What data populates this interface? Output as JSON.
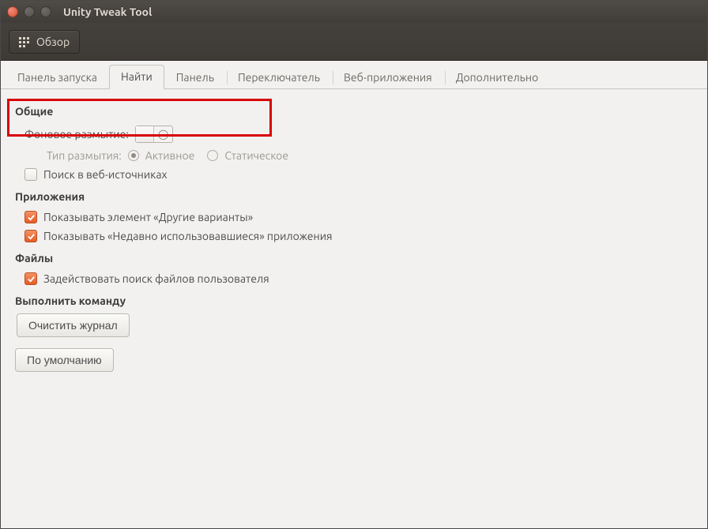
{
  "window": {
    "title": "Unity Tweak Tool"
  },
  "toolbar": {
    "overview_label": "Обзор"
  },
  "tabs": [
    {
      "label": "Панель запуска"
    },
    {
      "label": "Найти"
    },
    {
      "label": "Панель"
    },
    {
      "label": "Переключатель"
    },
    {
      "label": "Веб-приложения"
    },
    {
      "label": "Дополнительно"
    }
  ],
  "sections": {
    "general": {
      "title": "Общие",
      "blur_label": "Фоновое размытие:",
      "blur_type_label": "Тип размытия:",
      "blur_type_options": {
        "active": "Активное",
        "static": "Статическое"
      },
      "search_web_label": "Поиск в веб-источниках"
    },
    "apps": {
      "title": "Приложения",
      "show_more": "Показывать элемент «Другие варианты»",
      "show_recent": "Показывать «Недавно использовавшиеся» приложения"
    },
    "files": {
      "title": "Файлы",
      "user_files": "Задействовать поиск файлов пользователя"
    },
    "run": {
      "title": "Выполнить команду",
      "clear_btn": "Очистить журнал"
    }
  },
  "footer": {
    "defaults_btn": "По умолчанию"
  }
}
